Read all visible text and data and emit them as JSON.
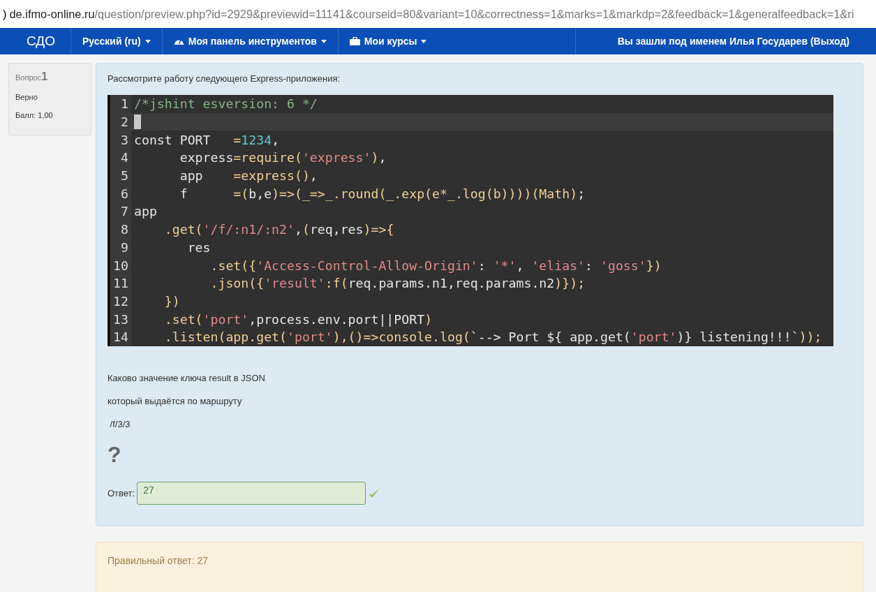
{
  "address_bar": {
    "edge_glyph": ")",
    "host": "de.ifmo-online.ru",
    "path": "/question/preview.php?id=2929&previewid=11141&courseid=80&variant=10&correctness=1&marks=1&markdp=2&feedback=1&generalfeedback=1&ri"
  },
  "navbar": {
    "brand": "СДО",
    "menus": [
      {
        "label": "Русский (ru)"
      },
      {
        "label": "Моя панель инструментов"
      },
      {
        "label": "Мои курсы"
      }
    ],
    "user": "Вы зашли под именем Илья Государев (Выход)"
  },
  "question_info": {
    "label": "Вопрос",
    "number": "1",
    "state": "Верно",
    "grade": "Балл: 1,00"
  },
  "question": {
    "intro": "Рассмотрите работу следующего Express-приложения:",
    "code": [
      {
        "number": "1",
        "current": false,
        "tokens": [
          {
            "kind": "comment",
            "text": "/*jshint esversion: 6 */"
          }
        ]
      },
      {
        "number": "2",
        "current": true
      },
      {
        "number": "3",
        "current": false,
        "tokens": [
          {
            "kind": "plain",
            "text": "const PORT   "
          },
          {
            "kind": "op",
            "text": "="
          },
          {
            "kind": "num",
            "text": "1234"
          },
          {
            "kind": "plain",
            "text": ","
          }
        ]
      },
      {
        "number": "4",
        "current": false,
        "tokens": [
          {
            "kind": "plain",
            "text": "      express"
          },
          {
            "kind": "op",
            "text": "=require("
          },
          {
            "kind": "str",
            "text": "'express'"
          },
          {
            "kind": "op",
            "text": ")"
          },
          {
            "kind": "plain",
            "text": ","
          }
        ]
      },
      {
        "number": "5",
        "current": false,
        "tokens": [
          {
            "kind": "plain",
            "text": "      app    "
          },
          {
            "kind": "op",
            "text": "=express()"
          },
          {
            "kind": "plain",
            "text": ","
          }
        ]
      },
      {
        "number": "6",
        "current": false,
        "tokens": [
          {
            "kind": "plain",
            "text": "      f      "
          },
          {
            "kind": "op",
            "text": "=("
          },
          {
            "kind": "plain",
            "text": "b,e"
          },
          {
            "kind": "op",
            "text": ")=>(_=>_.round(_.exp(e*_.log(b))))(Math)"
          },
          {
            "kind": "plain",
            "text": ";"
          }
        ]
      },
      {
        "number": "7",
        "current": false,
        "tokens": [
          {
            "kind": "plain",
            "text": "app"
          }
        ]
      },
      {
        "number": "8",
        "current": false,
        "tokens": [
          {
            "kind": "op",
            "text": "    .get("
          },
          {
            "kind": "str",
            "text": "'/f/:n1/:n2'"
          },
          {
            "kind": "plain",
            "text": ","
          },
          {
            "kind": "op",
            "text": "("
          },
          {
            "kind": "plain",
            "text": "req,res"
          },
          {
            "kind": "op",
            "text": ")=>{"
          }
        ]
      },
      {
        "number": "9",
        "current": false,
        "tokens": [
          {
            "kind": "plain",
            "text": "       res"
          }
        ]
      },
      {
        "number": "10",
        "current": false,
        "tokens": [
          {
            "kind": "op",
            "text": "          .set({"
          },
          {
            "kind": "str",
            "text": "'Access-Control-Allow-Origin'"
          },
          {
            "kind": "plain",
            "text": ": "
          },
          {
            "kind": "str",
            "text": "'*'"
          },
          {
            "kind": "plain",
            "text": ", "
          },
          {
            "kind": "str",
            "text": "'elias'"
          },
          {
            "kind": "plain",
            "text": ": "
          },
          {
            "kind": "str",
            "text": "'goss'"
          },
          {
            "kind": "op",
            "text": "})"
          }
        ]
      },
      {
        "number": "11",
        "current": false,
        "tokens": [
          {
            "kind": "op",
            "text": "          .json({"
          },
          {
            "kind": "str",
            "text": "'result'"
          },
          {
            "kind": "op",
            "text": ":f("
          },
          {
            "kind": "plain",
            "text": "req.params.n1,req.params.n2"
          },
          {
            "kind": "op",
            "text": ")});"
          }
        ]
      },
      {
        "number": "12",
        "current": false,
        "tokens": [
          {
            "kind": "op",
            "text": "    })"
          }
        ]
      },
      {
        "number": "13",
        "current": false,
        "tokens": [
          {
            "kind": "op",
            "text": "    .set("
          },
          {
            "kind": "str",
            "text": "'port'"
          },
          {
            "kind": "plain",
            "text": ",process.env.port||PORT"
          },
          {
            "kind": "op",
            "text": ")"
          }
        ]
      },
      {
        "number": "14",
        "current": false,
        "tokens": [
          {
            "kind": "op",
            "text": "    .listen(app.get("
          },
          {
            "kind": "str",
            "text": "'port'"
          },
          {
            "kind": "op",
            "text": "),()=>console.log("
          },
          {
            "kind": "plain",
            "text": "`--> Port ${ app.get("
          },
          {
            "kind": "str",
            "text": "'port'"
          },
          {
            "kind": "plain",
            "text": ")} listening!!!`"
          },
          {
            "kind": "op",
            "text": "));"
          }
        ]
      }
    ],
    "paragraphs": [
      "Каково значение ключа result в JSON",
      "который выдаётся по маршруту",
      " /f/3/3"
    ],
    "mark": "?",
    "answer_label": "Ответ:",
    "answer": "27",
    "correct": true
  },
  "feedback": {
    "text": "Правильный ответ: 27"
  }
}
